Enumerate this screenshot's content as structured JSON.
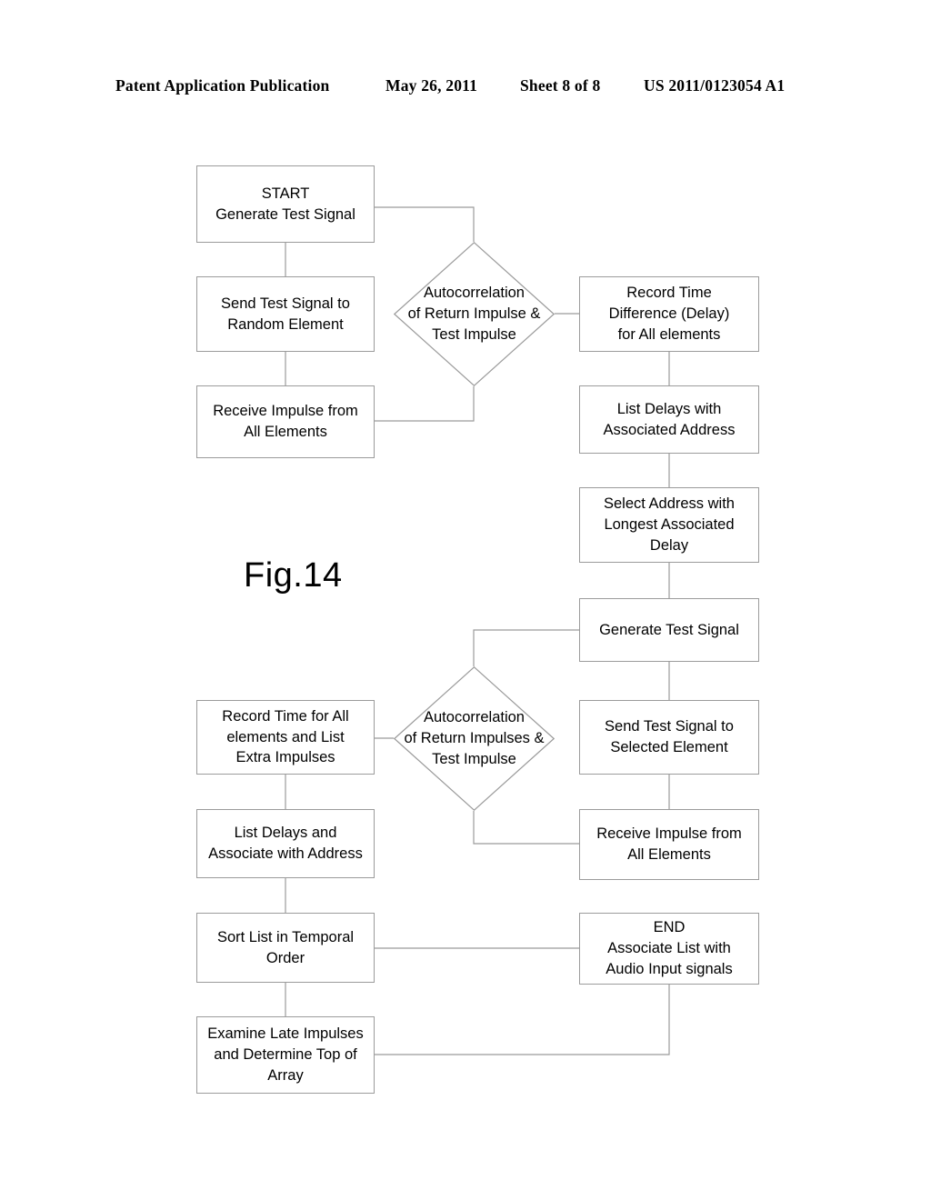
{
  "header": {
    "publication": "Patent Application Publication",
    "date": "May 26, 2011",
    "sheet": "Sheet 8 of 8",
    "patent_number": "US 2011/0123054 A1"
  },
  "figure": {
    "caption": "Fig.14"
  },
  "colors": {
    "box_border": "#9b9b9b",
    "connector": "#9b9b9b",
    "text": "#000000",
    "background": "#ffffff"
  },
  "chart_data": {
    "type": "diagram",
    "diagram_type": "flowchart",
    "title": "Fig.14",
    "nodes": [
      {
        "id": "start",
        "shape": "process",
        "text": "START\nGenerate Test Signal"
      },
      {
        "id": "send_random",
        "shape": "process",
        "text": "Send Test Signal to\nRandom Element"
      },
      {
        "id": "receive_all_1",
        "shape": "process",
        "text": "Receive Impulse from\nAll Elements"
      },
      {
        "id": "autocorr_1",
        "shape": "decision",
        "text": "Autocorrelation\nof Return Impulse &\nTest Impulse"
      },
      {
        "id": "record_time_diff",
        "shape": "process",
        "text": "Record Time\nDifference (Delay)\nfor All elements"
      },
      {
        "id": "list_delays_addr",
        "shape": "process",
        "text": "List Delays with\nAssociated Address"
      },
      {
        "id": "select_address",
        "shape": "process",
        "text": "Select Address with\nLongest Associated\nDelay"
      },
      {
        "id": "generate_test",
        "shape": "process",
        "text": "Generate Test Signal"
      },
      {
        "id": "send_selected",
        "shape": "process",
        "text": "Send Test Signal to\nSelected Element"
      },
      {
        "id": "receive_all_2",
        "shape": "process",
        "text": "Receive Impulse from\nAll Elements"
      },
      {
        "id": "autocorr_2",
        "shape": "decision",
        "text": "Autocorrelation\nof Return Impulses &\nTest Impulse"
      },
      {
        "id": "record_time_all",
        "shape": "process",
        "text": "Record Time for All\nelements and List\nExtra Impulses"
      },
      {
        "id": "list_delays_assoc",
        "shape": "process",
        "text": "List Delays and\nAssociate with Address"
      },
      {
        "id": "sort_list",
        "shape": "process",
        "text": "Sort List in Temporal\nOrder"
      },
      {
        "id": "examine_late",
        "shape": "process",
        "text": "Examine Late Impulses\nand Determine Top of\nArray"
      },
      {
        "id": "end",
        "shape": "process",
        "text": "END\nAssociate List with\nAudio Input signals"
      }
    ],
    "edges": [
      {
        "from": "start",
        "to": "send_random"
      },
      {
        "from": "send_random",
        "to": "receive_all_1"
      },
      {
        "from": "start",
        "to": "autocorr_1"
      },
      {
        "from": "autocorr_1",
        "to": "receive_all_1"
      },
      {
        "from": "autocorr_1",
        "to": "record_time_diff"
      },
      {
        "from": "record_time_diff",
        "to": "list_delays_addr"
      },
      {
        "from": "list_delays_addr",
        "to": "select_address"
      },
      {
        "from": "select_address",
        "to": "generate_test"
      },
      {
        "from": "generate_test",
        "to": "autocorr_2"
      },
      {
        "from": "generate_test",
        "to": "send_selected"
      },
      {
        "from": "send_selected",
        "to": "receive_all_2"
      },
      {
        "from": "autocorr_2",
        "to": "receive_all_2"
      },
      {
        "from": "autocorr_2",
        "to": "record_time_all"
      },
      {
        "from": "record_time_all",
        "to": "list_delays_assoc"
      },
      {
        "from": "list_delays_assoc",
        "to": "sort_list"
      },
      {
        "from": "sort_list",
        "to": "end"
      },
      {
        "from": "sort_list",
        "to": "examine_late"
      },
      {
        "from": "examine_late",
        "to": "end"
      }
    ]
  }
}
